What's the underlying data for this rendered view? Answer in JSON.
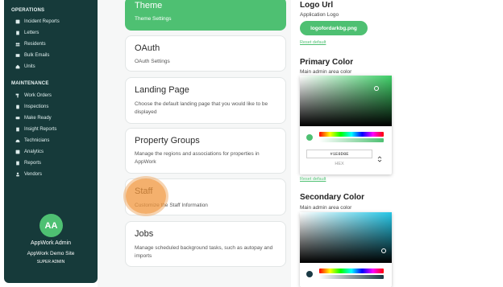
{
  "sidebar": {
    "sections": [
      {
        "title": "OPERATIONS",
        "items": [
          {
            "label": "Incident Reports",
            "icon": "report-icon"
          },
          {
            "label": "Letters",
            "icon": "letter-icon"
          },
          {
            "label": "Residents",
            "icon": "people-icon"
          },
          {
            "label": "Bulk Emails",
            "icon": "mail-icon"
          },
          {
            "label": "Units",
            "icon": "home-icon"
          }
        ]
      },
      {
        "title": "MAINTENANCE",
        "items": [
          {
            "label": "Work Orders",
            "icon": "hammer-icon"
          },
          {
            "label": "Inspections",
            "icon": "clipboard-icon"
          },
          {
            "label": "Make Ready",
            "icon": "paint-icon"
          },
          {
            "label": "Insight Reports",
            "icon": "file-icon"
          },
          {
            "label": "Technicians",
            "icon": "hardhat-icon"
          },
          {
            "label": "Analytics",
            "icon": "chart-icon"
          },
          {
            "label": "Reports",
            "icon": "document-icon"
          },
          {
            "label": "Vendors",
            "icon": "user-icon"
          }
        ]
      }
    ],
    "user": {
      "initials": "AA",
      "name": "AppWork Admin",
      "site": "AppWork Demo Site",
      "role": "SUPER ADMIN"
    }
  },
  "cards": [
    {
      "title": "Theme",
      "desc": "Theme Settings",
      "active": true
    },
    {
      "title": "OAuth",
      "desc": "OAuth Settings"
    },
    {
      "title": "Landing Page",
      "desc": "Choose the default landing page that you would like to be displayed"
    },
    {
      "title": "Property Groups",
      "desc": "Manage the regions and associations for properties in AppWork"
    },
    {
      "title": "Staff",
      "desc": "Customize the Staff Information"
    },
    {
      "title": "Jobs",
      "desc": "Manage scheduled background tasks, such as autopay and imports"
    }
  ],
  "settings": {
    "logo": {
      "title": "Logo Url",
      "subtitle": "Application Logo",
      "file": "logofordarkbg.png",
      "reset": "Reset default"
    },
    "primary": {
      "title": "Primary Color",
      "subtitle": "Main admin area color",
      "hex": "#1E8D8E",
      "hex_label": "HEX",
      "reset": "Reset default",
      "swatch": "#4ec072"
    },
    "secondary": {
      "title": "Secondary Color",
      "subtitle": "Main admin area color",
      "swatch": "#1a3a45"
    }
  },
  "colors": {
    "sidebar": "#163a3a",
    "accent": "#4ec072",
    "highlight": "#f0963c"
  }
}
